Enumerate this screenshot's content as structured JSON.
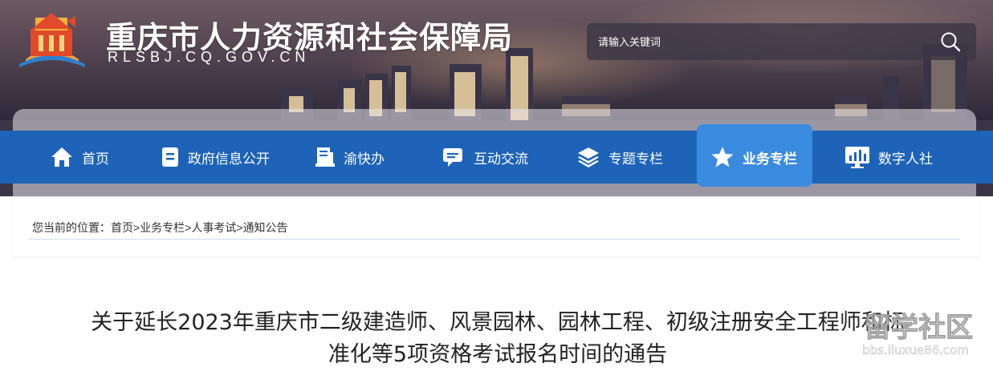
{
  "header": {
    "title": "重庆市人力资源和社会保障局",
    "domain": "RLSBJ.CQ.GOV.CN"
  },
  "search": {
    "placeholder": "请输入关键词"
  },
  "nav": {
    "items": [
      {
        "label": "首页",
        "icon": "home-icon"
      },
      {
        "label": "政府信息公开",
        "icon": "document-icon"
      },
      {
        "label": "渝快办",
        "icon": "service-icon"
      },
      {
        "label": "互动交流",
        "icon": "chat-icon"
      },
      {
        "label": "专题专栏",
        "icon": "layers-icon"
      },
      {
        "label": "业务专栏",
        "icon": "star-icon",
        "active": true
      },
      {
        "label": "数字人社",
        "icon": "monitor-chart-icon"
      }
    ]
  },
  "breadcrumb": {
    "prefix": "您当前的位置：",
    "items": [
      "首页",
      "业务专栏",
      "人事考试",
      "通知公告"
    ],
    "separator": ">"
  },
  "article": {
    "title_line1": "关于延长2023年重庆市二级建造师、风景园林、园林工程、初级注册安全工程师和标",
    "title_line2": "准化等5项资格考试报名时间的通告"
  },
  "watermark": {
    "text": "留学社区",
    "url_text": "bbs.liuxue86.com"
  },
  "colors": {
    "nav_bg": "#1d63b8",
    "nav_active": "#3a8be0",
    "text": "#222222"
  }
}
